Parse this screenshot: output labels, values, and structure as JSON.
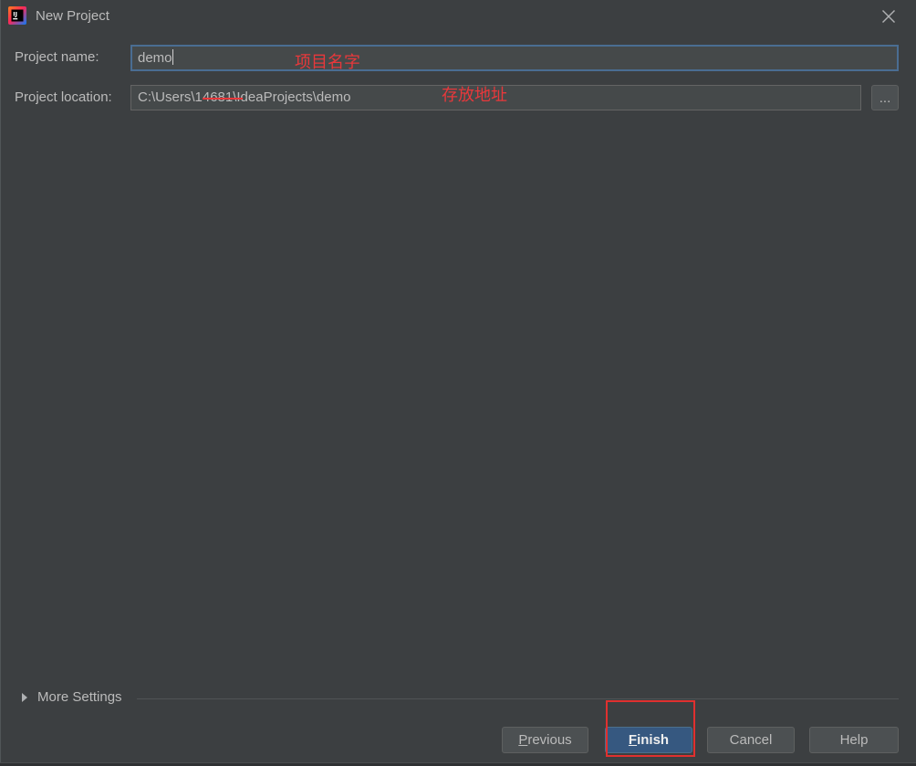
{
  "window": {
    "title": "New Project",
    "icon": "intellij-idea-icon",
    "logo_text": "IJ",
    "close_icon": "close-icon"
  },
  "form": {
    "name_label": "Project name:",
    "name_value": "demo",
    "location_label": "Project location:",
    "location_value": "C:\\Users\\14681\\IdeaProjects\\demo",
    "browse_label": "..."
  },
  "annotations": {
    "name_note": "项目名字",
    "location_note": "存放地址",
    "color": "#e8383b"
  },
  "more_settings": {
    "label": "More Settings",
    "expanded": false,
    "icon": "expand-triangle-icon"
  },
  "buttons": {
    "previous": "Previous",
    "finish": "Finish",
    "cancel": "Cancel",
    "help": "Help",
    "default": "finish"
  },
  "colors": {
    "background": "#3c3f41",
    "field_background": "#45494a",
    "focus_border": "#4a6d92",
    "default_button": "#365880",
    "text": "#bbbbbb"
  }
}
